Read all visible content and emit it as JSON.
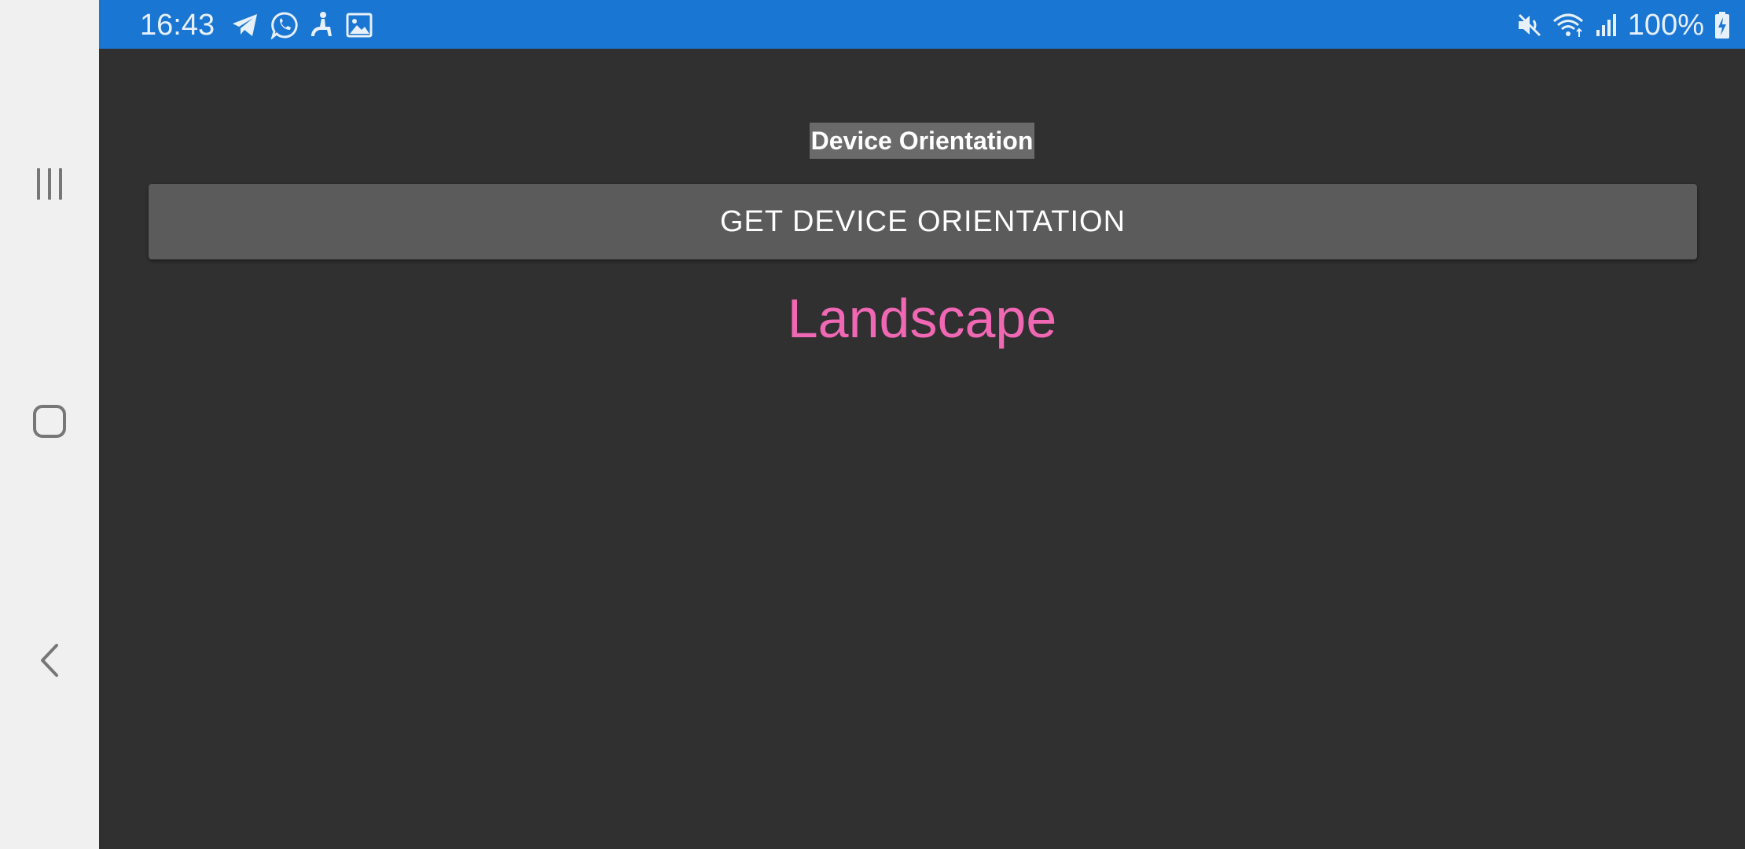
{
  "status_bar": {
    "time": "16:43",
    "battery_percent": "100%",
    "notification_icons": [
      "telegram-icon",
      "whatsapp-icon",
      "accessibility-icon",
      "image-icon"
    ],
    "system_icons": [
      "mute-icon",
      "wifi-icon",
      "signal-icon",
      "battery-charging-icon"
    ],
    "background_color": "#1976d2"
  },
  "navigation_bar": {
    "buttons": [
      "recents-icon",
      "home-icon",
      "back-icon"
    ]
  },
  "page": {
    "title": "Device Orientation",
    "button_label": "GET DEVICE ORIENTATION",
    "result": "Landscape",
    "result_color": "#f067b4",
    "background_color": "#303030"
  }
}
